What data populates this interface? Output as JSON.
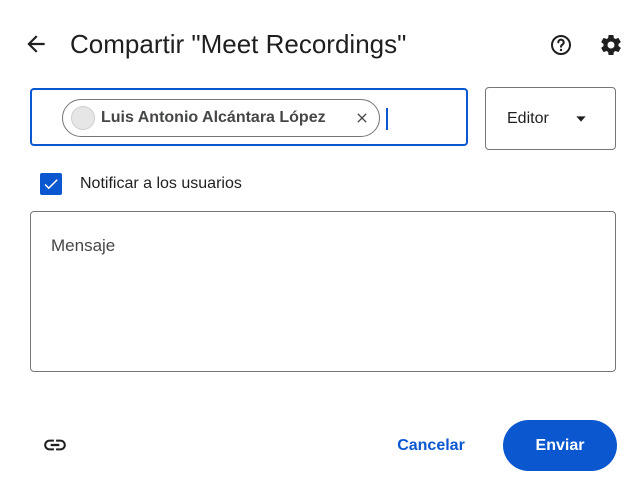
{
  "header": {
    "back_icon": "arrow-back-icon",
    "title": "Compartir \"Meet Recordings\"",
    "help_icon": "help-icon",
    "settings_icon": "gear-icon"
  },
  "recipients": {
    "chips": [
      {
        "label": "Luis Antonio Alcántara López",
        "avatar_icon": "avatar-icon",
        "remove_icon": "close-icon"
      }
    ]
  },
  "role": {
    "selected": "Editor",
    "arrow_icon": "arrow-drop-down-icon"
  },
  "notify": {
    "checked": true,
    "label": "Notificar a los usuarios"
  },
  "message": {
    "placeholder": "Mensaje"
  },
  "footer": {
    "link_icon": "link-icon",
    "cancel_label": "Cancelar",
    "send_label": "Enviar"
  },
  "colors": {
    "accent": "#0b57d0",
    "text": "#1f1f1f",
    "border": "#747775"
  }
}
